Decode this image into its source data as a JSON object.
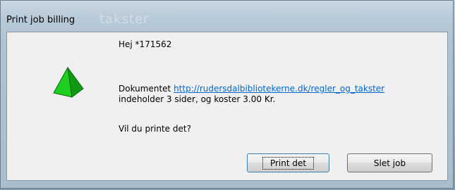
{
  "window": {
    "title": "Print job billing",
    "ghost_text": "takster"
  },
  "icon": "green-pyramid-icon",
  "message": {
    "greeting": "Hej *171562",
    "doc_prefix": "Dokumentet ",
    "doc_link": "http://rudersdalbibliotekerne.dk/regler_og_takster",
    "doc_details": "indeholder 3 sider, og koster 3.00 Kr.",
    "question": "Vil du printe det?"
  },
  "buttons": {
    "print_label": "Print det",
    "delete_label": "Slet job"
  },
  "colors": {
    "link": "#0066cc",
    "client_bg": "#f0f0f0",
    "pyramid": "#22cc22"
  }
}
